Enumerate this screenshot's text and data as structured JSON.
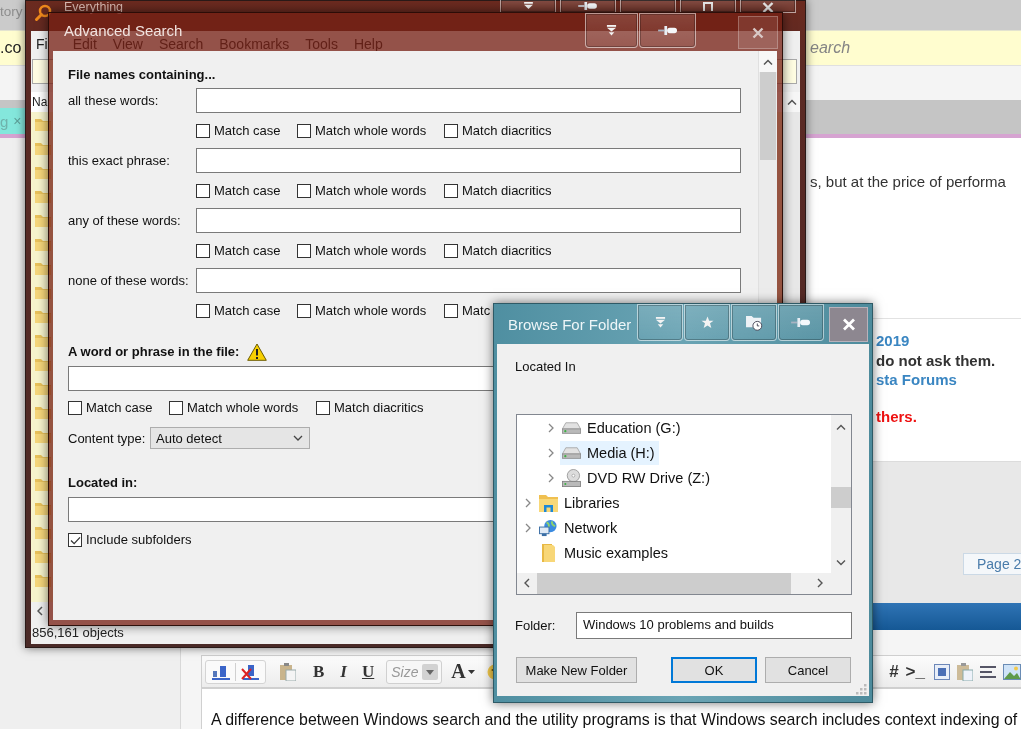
{
  "browser": {
    "tab_title": "tory",
    "address": ".co",
    "search_placeholder": "earch",
    "tab": {
      "label": "g",
      "close": "×"
    },
    "article_text": "s, but at the price of performa",
    "post_lines": [
      {
        "kind": "link",
        "text": "2019"
      },
      {
        "kind": "strong",
        "text": "do not ask them."
      },
      {
        "kind": "link",
        "text": "sta Forums"
      },
      {
        "kind": "alert",
        "text": "thers."
      }
    ],
    "page_button": "Page 2",
    "toolbar_left": [
      {
        "kind": "bold",
        "label": "B"
      },
      {
        "kind": "italic",
        "label": "I"
      },
      {
        "kind": "underline",
        "label": "U"
      }
    ],
    "size_placeholder": "Size",
    "font_color": "A",
    "toolbar_right": [
      {
        "kind": "hashtag",
        "label": "#"
      },
      {
        "kind": "code",
        "label": ">_"
      }
    ],
    "editor_text": "A difference between Windows search and the utility programs is that Windows search includes context indexing of"
  },
  "everything": {
    "title": "Everything",
    "menu": [
      "Fi",
      "Edit",
      "View",
      "Search",
      "Bookmarks",
      "Tools",
      "Help"
    ],
    "column_header": "Na",
    "status": "856,161 objects"
  },
  "advanced_search": {
    "title": "Advanced Search",
    "filename_heading": "File names containing...",
    "filename_rows": [
      {
        "label": "all these words:",
        "options": [
          {
            "label": "Match case",
            "checked": false
          },
          {
            "label": "Match whole words",
            "checked": false
          },
          {
            "label": "Match diacritics",
            "checked": false
          }
        ]
      },
      {
        "label": "this exact phrase:",
        "options": [
          {
            "label": "Match case",
            "checked": false
          },
          {
            "label": "Match whole words",
            "checked": false
          },
          {
            "label": "Match diacritics",
            "checked": false
          }
        ]
      },
      {
        "label": "any of these words:",
        "options": [
          {
            "label": "Match case",
            "checked": false
          },
          {
            "label": "Match whole words",
            "checked": false
          },
          {
            "label": "Match diacritics",
            "checked": false
          }
        ]
      },
      {
        "label": "none of these words:",
        "options": [
          {
            "label": "Match case",
            "checked": false
          },
          {
            "label": "Match whole words",
            "checked": false
          },
          {
            "label": "Matc",
            "checked": false
          }
        ]
      }
    ],
    "content_heading": "A word or phrase in the file:",
    "content_options": [
      {
        "label": "Match case",
        "checked": false
      },
      {
        "label": "Match whole words",
        "checked": false
      },
      {
        "label": "Match diacritics",
        "checked": false
      }
    ],
    "content_type_label": "Content type:",
    "content_type_value": "Auto detect",
    "location_heading": "Located in:",
    "include_subfolders": {
      "label": "Include subfolders",
      "checked": true
    }
  },
  "browse_folder": {
    "title": "Browse For Folder",
    "heading": "Located In",
    "tree": [
      {
        "children": [
          {
            "label": "Education (G:)",
            "kind": "drive",
            "expandable": true,
            "selected": false
          },
          {
            "label": "Media (H:)",
            "kind": "drive",
            "expandable": true,
            "selected": true
          },
          {
            "label": "DVD RW Drive (Z:)",
            "kind": "optical-drive",
            "expandable": true,
            "selected": false
          }
        ]
      },
      {
        "label": "Libraries",
        "kind": "library",
        "expandable": true,
        "selected": false
      },
      {
        "label": "Network",
        "kind": "network",
        "expandable": true,
        "selected": false
      },
      {
        "label": "Music examples",
        "kind": "folder",
        "expandable": false,
        "selected": false
      }
    ],
    "folder_label": "Folder:",
    "folder_value": "Windows 10 problems and builds",
    "buttons": [
      {
        "label": "Make New Folder",
        "kind": "normal"
      },
      {
        "label": "OK",
        "kind": "default"
      },
      {
        "label": "Cancel",
        "kind": "normal"
      }
    ]
  }
}
